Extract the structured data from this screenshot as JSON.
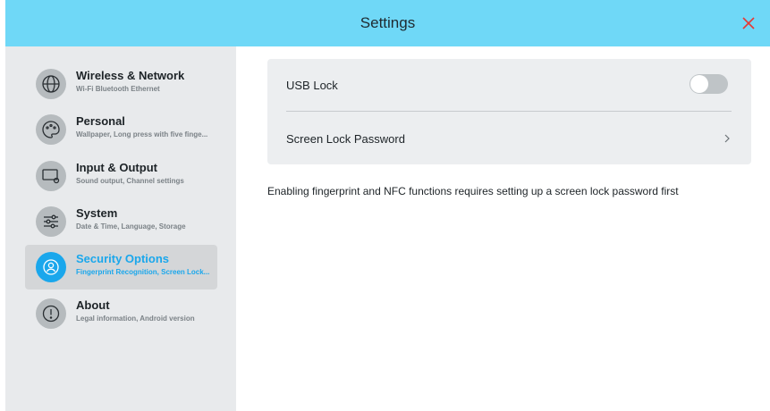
{
  "header": {
    "title": "Settings"
  },
  "sidebar": {
    "items": [
      {
        "title": "Wireless & Network",
        "subtitle": "Wi-Fi Bluetooth Ethernet",
        "icon": "globe-icon"
      },
      {
        "title": "Personal",
        "subtitle": "Wallpaper, Long press with five finge...",
        "icon": "palette-icon"
      },
      {
        "title": "Input & Output",
        "subtitle": "Sound output, Channel settings",
        "icon": "monitor-settings-icon"
      },
      {
        "title": "System",
        "subtitle": "Date & Time, Language, Storage",
        "icon": "sliders-icon"
      },
      {
        "title": "Security Options",
        "subtitle": "Fingerprint Recognition, Screen Lock...",
        "icon": "user-shield-icon",
        "active": true
      },
      {
        "title": "About",
        "subtitle": "Legal information, Android version",
        "icon": "info-icon"
      }
    ]
  },
  "main": {
    "usb_lock": {
      "label": "USB Lock",
      "enabled": false
    },
    "screen_lock_password": {
      "label": "Screen Lock Password"
    },
    "info_text": "Enabling fingerprint and NFC functions requires setting up a screen lock password first"
  },
  "colors": {
    "header": "#6fd8f7",
    "accent": "#1aa7ec",
    "close": "#e53935"
  }
}
